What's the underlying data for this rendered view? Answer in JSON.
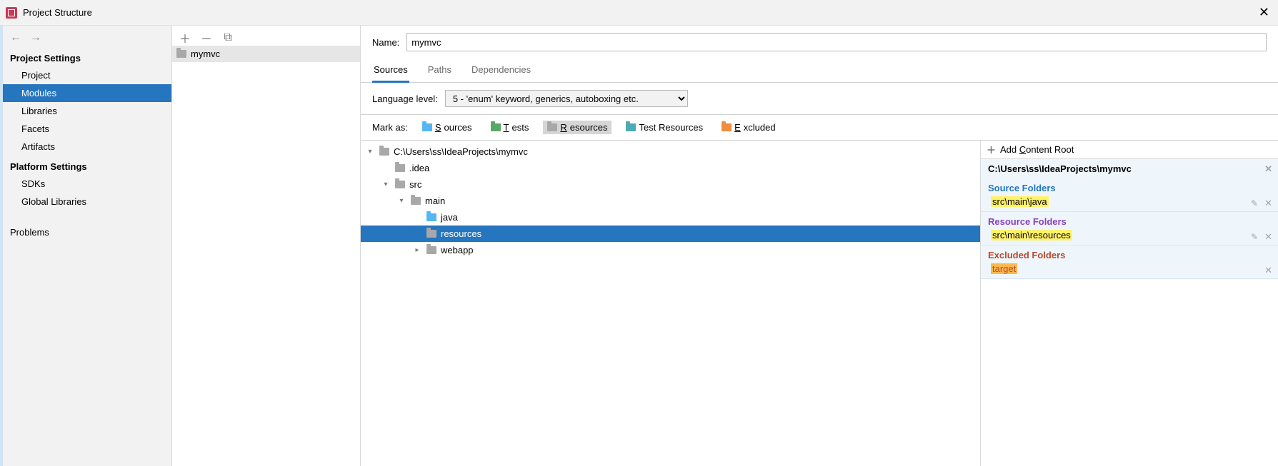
{
  "window": {
    "title": "Project Structure"
  },
  "sidebar": {
    "sections": {
      "project_settings": {
        "header": "Project Settings",
        "items": [
          "Project",
          "Modules",
          "Libraries",
          "Facets",
          "Artifacts"
        ],
        "active": "Modules"
      },
      "platform_settings": {
        "header": "Platform Settings",
        "items": [
          "SDKs",
          "Global Libraries"
        ]
      },
      "problems": {
        "item": "Problems"
      }
    }
  },
  "modules": {
    "items": [
      "mymvc"
    ]
  },
  "form": {
    "name_label": "Name:",
    "name_value": "mymvc",
    "tabs": [
      "Sources",
      "Paths",
      "Dependencies"
    ],
    "active_tab": "Sources",
    "lang_label": "Language level:",
    "lang_value": "5 - 'enum' keyword, generics, autoboxing etc.",
    "mark_label": "Mark as:",
    "mark_buttons": {
      "sources": "Sources",
      "tests": "Tests",
      "resources": "Resources",
      "test_resources": "Test Resources",
      "excluded": "Excluded"
    },
    "mark_selected": "resources"
  },
  "tree": {
    "root": "C:\\Users\\ss\\IdeaProjects\\mymvc",
    "nodes": [
      {
        "name": ".idea",
        "level": 1,
        "caret": "",
        "icon": "gray"
      },
      {
        "name": "src",
        "level": 1,
        "caret": "down",
        "icon": "gray"
      },
      {
        "name": "main",
        "level": 2,
        "caret": "down",
        "icon": "gray"
      },
      {
        "name": "java",
        "level": 3,
        "caret": "",
        "icon": "blue"
      },
      {
        "name": "resources",
        "level": 3,
        "caret": "",
        "icon": "gray",
        "selected": true
      },
      {
        "name": "webapp",
        "level": 3,
        "caret": "right",
        "icon": "gray"
      }
    ]
  },
  "roots": {
    "add_label": "Add Content Root",
    "path": "C:\\Users\\ss\\IdeaProjects\\mymvc",
    "source_hdr": "Source Folders",
    "source_item": "src\\main\\java",
    "resource_hdr": "Resource Folders",
    "resource_item": "src\\main\\resources",
    "excluded_hdr": "Excluded Folders",
    "excluded_item": "target"
  }
}
